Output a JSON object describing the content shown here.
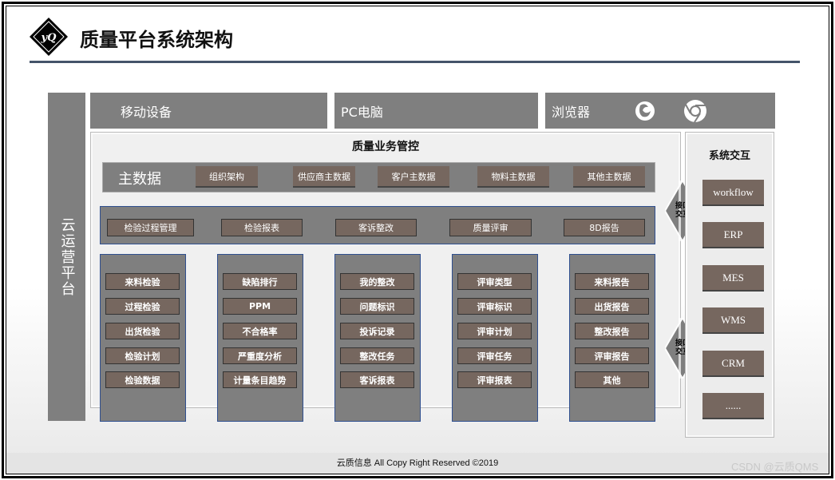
{
  "header": {
    "logo_text": "YQ",
    "title": "质量平台系统架构"
  },
  "left_bar": {
    "label": "云运营平台"
  },
  "top_row": [
    {
      "label": "移动设备"
    },
    {
      "label": "PC电脑"
    },
    {
      "label": "浏览器",
      "icons": [
        "firefox-icon",
        "chrome-icon"
      ]
    }
  ],
  "main": {
    "title": "质量业务管控",
    "master_data": {
      "label": "主数据",
      "items": [
        "组织架构",
        "供应商主数据",
        "客户主数据",
        "物料主数据",
        "其他主数据"
      ]
    },
    "modules": [
      "检验过程管理",
      "检验报表",
      "客诉整改",
      "质量评审",
      "8D报告"
    ],
    "columns": [
      [
        "来料检验",
        "过程检验",
        "出货检验",
        "检验计划",
        "检验数据"
      ],
      [
        "缺陷排行",
        "PPM",
        "不合格率",
        "严重度分析",
        "计量条目趋势"
      ],
      [
        "我的整改",
        "问题标识",
        "投诉记录",
        "整改任务",
        "客诉报表"
      ],
      [
        "评审类型",
        "评审标识",
        "评审计划",
        "评审任务",
        "评审报表"
      ],
      [
        "来料报告",
        "出货报告",
        "整改报告",
        "评审报告",
        "其他"
      ]
    ]
  },
  "interface": {
    "line1": "接口",
    "line2": "交互"
  },
  "system": {
    "title": "系统交互",
    "items": [
      "workflow",
      "ERP",
      "MES",
      "WMS",
      "CRM",
      "......"
    ]
  },
  "footer": {
    "text": "云质信息 All Copy Right Reserved ©2019"
  },
  "watermark": "CSDN @云质QMS",
  "colors": {
    "gray": "#7f7f7f",
    "brown": "#76675f",
    "border_blue": "#2f4f8f",
    "rule": "#44546a"
  }
}
